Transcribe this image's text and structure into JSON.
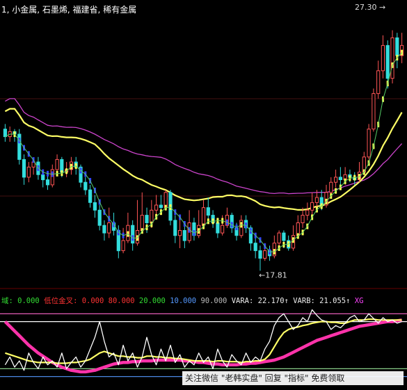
{
  "chart_data": [
    {
      "type": "candlestick",
      "panel": "price",
      "header": {
        "prefix": "1, ",
        "tags": [
          "小金属",
          "石墨烯",
          "福建省",
          "稀有金属"
        ]
      },
      "price_labels": {
        "high": "27.30",
        "low": "17.81"
      },
      "ylim": [
        17.3,
        28.0
      ],
      "candles": [
        [
          23.4,
          23.1,
          23.6,
          22.9
        ],
        [
          23.1,
          23.3,
          23.5,
          22.9
        ],
        [
          23.3,
          23.2,
          23.4,
          22.9
        ],
        [
          23.2,
          22.2,
          23.4,
          22.0
        ],
        [
          22.2,
          21.5,
          22.4,
          21.2
        ],
        [
          21.5,
          21.9,
          22.1,
          21.3
        ],
        [
          21.9,
          22.1,
          22.2,
          21.6
        ],
        [
          22.1,
          21.6,
          22.3,
          21.4
        ],
        [
          21.6,
          21.4,
          21.8,
          21.1
        ],
        [
          21.4,
          21.2,
          21.6,
          21.0
        ],
        [
          21.2,
          21.8,
          22.0,
          21.1
        ],
        [
          21.8,
          22.2,
          22.4,
          21.7
        ],
        [
          22.2,
          21.7,
          22.3,
          21.5
        ],
        [
          21.7,
          21.8,
          22.1,
          21.5
        ],
        [
          21.8,
          22.1,
          22.3,
          21.6
        ],
        [
          22.1,
          21.9,
          22.3,
          21.6
        ],
        [
          21.9,
          21.3,
          22.0,
          21.1
        ],
        [
          21.3,
          21.0,
          21.5,
          20.8
        ],
        [
          21.0,
          20.5,
          21.2,
          20.3
        ],
        [
          20.5,
          20.2,
          20.8,
          19.9
        ],
        [
          20.2,
          19.6,
          20.4,
          19.4
        ],
        [
          19.6,
          19.3,
          19.8,
          19.0
        ],
        [
          19.3,
          19.7,
          20.3,
          19.1
        ],
        [
          19.7,
          19.4,
          20.1,
          19.2
        ],
        [
          19.4,
          18.6,
          19.6,
          18.3
        ],
        [
          18.6,
          19.0,
          19.5,
          18.5
        ],
        [
          19.0,
          19.6,
          20.1,
          18.9
        ],
        [
          19.6,
          18.9,
          19.8,
          18.6
        ],
        [
          18.9,
          19.4,
          20.6,
          18.8
        ],
        [
          19.4,
          20.0,
          20.9,
          19.3
        ],
        [
          20.0,
          19.7,
          20.3,
          19.3
        ],
        [
          19.7,
          20.2,
          20.6,
          19.5
        ],
        [
          20.2,
          20.4,
          20.8,
          20.0
        ],
        [
          20.4,
          20.3,
          20.8,
          20.1
        ],
        [
          20.3,
          20.9,
          21.0,
          20.2
        ],
        [
          20.9,
          19.8,
          21.0,
          19.6
        ],
        [
          19.8,
          19.2,
          20.0,
          18.9
        ],
        [
          19.2,
          19.4,
          19.9,
          18.7
        ],
        [
          19.4,
          19.0,
          19.6,
          18.7
        ],
        [
          19.0,
          19.7,
          20.2,
          18.9
        ],
        [
          19.7,
          19.2,
          19.9,
          19.0
        ],
        [
          19.2,
          19.6,
          20.2,
          19.1
        ],
        [
          19.6,
          20.3,
          20.6,
          19.5
        ],
        [
          20.3,
          20.0,
          20.7,
          19.8
        ],
        [
          20.0,
          19.7,
          20.2,
          19.5
        ],
        [
          19.7,
          19.3,
          19.9,
          19.1
        ],
        [
          19.3,
          19.6,
          20.0,
          19.2
        ],
        [
          19.6,
          20.0,
          20.3,
          19.5
        ],
        [
          20.0,
          19.5,
          20.1,
          19.3
        ],
        [
          19.5,
          19.2,
          19.7,
          19.0
        ],
        [
          19.2,
          19.8,
          20.0,
          19.1
        ],
        [
          19.8,
          19.5,
          20.0,
          19.3
        ],
        [
          19.5,
          18.9,
          19.6,
          18.6
        ],
        [
          18.9,
          18.6,
          19.1,
          18.3
        ],
        [
          18.6,
          18.3,
          18.8,
          17.81
        ],
        [
          18.3,
          18.6,
          18.9,
          18.2
        ],
        [
          18.6,
          18.4,
          18.8,
          18.2
        ],
        [
          18.4,
          18.9,
          19.2,
          18.3
        ],
        [
          18.9,
          19.3,
          19.4,
          18.6
        ],
        [
          19.3,
          19.0,
          19.4,
          18.7
        ],
        [
          19.0,
          18.7,
          19.2,
          18.6
        ],
        [
          18.7,
          19.2,
          19.6,
          18.6
        ],
        [
          19.2,
          19.7,
          20.0,
          19.1
        ],
        [
          19.7,
          20.0,
          20.3,
          19.5
        ],
        [
          20.0,
          20.2,
          20.5,
          19.8
        ],
        [
          20.2,
          20.5,
          20.9,
          20.0
        ],
        [
          20.5,
          20.7,
          21.0,
          20.3
        ],
        [
          20.7,
          20.4,
          21.0,
          20.2
        ],
        [
          20.4,
          20.9,
          21.2,
          20.3
        ],
        [
          20.9,
          21.3,
          21.5,
          20.7
        ],
        [
          21.3,
          21.5,
          21.8,
          21.1
        ],
        [
          21.5,
          21.4,
          21.9,
          21.2
        ],
        [
          21.4,
          21.6,
          21.9,
          21.2
        ],
        [
          21.6,
          21.5,
          21.8,
          21.3
        ],
        [
          21.5,
          21.4,
          21.7,
          21.2
        ],
        [
          21.4,
          21.7,
          22.1,
          21.3
        ],
        [
          21.7,
          22.3,
          22.5,
          21.6
        ],
        [
          22.3,
          23.4,
          23.6,
          22.2
        ],
        [
          23.4,
          24.8,
          25.0,
          23.3
        ],
        [
          24.8,
          25.7,
          26.1,
          24.6
        ],
        [
          25.7,
          26.7,
          27.1,
          25.4
        ],
        [
          26.7,
          25.4,
          26.9,
          25.0
        ],
        [
          25.4,
          27.0,
          27.3,
          25.2
        ],
        [
          27.0,
          26.3,
          27.2,
          25.8
        ],
        [
          26.3,
          26.7,
          27.2,
          26.0
        ]
      ],
      "ma_short_color": "#ffffff",
      "ma_mid_color": "#ffff66",
      "ma_long_color": "#cc44cc",
      "bull_color": "#ff5555",
      "bear_color": "#33dddd",
      "trend_up_color": "#ffff55",
      "trend_down_color": "#3344ff"
    },
    {
      "type": "line",
      "panel": "indicator",
      "header": [
        {
          "label": "域:",
          "value": "0.000",
          "color": "#33dd33"
        },
        {
          "label": "低位金叉:",
          "value": "0.000",
          "color": "#ff3333"
        },
        {
          "label": "",
          "value": "80.000",
          "color": "#ff3333"
        },
        {
          "label": "",
          "value": "20.000",
          "color": "#33dd33"
        },
        {
          "label": "",
          "value": "10.000",
          "color": "#5599ff"
        },
        {
          "label": "",
          "value": "90.000",
          "color": "#bbbbbb"
        },
        {
          "label": "VARA:",
          "value": "22.170↑",
          "color": "#eeeeee"
        },
        {
          "label": "VARB:",
          "value": "21.055↑",
          "color": "#eeeeee"
        },
        {
          "label": "XG",
          "value": "",
          "color": "#ff44ff"
        }
      ],
      "ylim": [
        0,
        100
      ],
      "levels": [
        {
          "value": 90,
          "color": "#ff66cc"
        },
        {
          "value": 80,
          "color": "#ffffff"
        },
        {
          "value": 20,
          "color": "#88cc88"
        },
        {
          "value": 10,
          "color": "#5599ff"
        }
      ],
      "series": [
        {
          "name": "VARA",
          "color": "#ffffff",
          "values": [
            25,
            35,
            22,
            30,
            18,
            40,
            28,
            20,
            35,
            25,
            30,
            22,
            40,
            20,
            28,
            35,
            22,
            30,
            45,
            60,
            80,
            55,
            35,
            40,
            25,
            50,
            30,
            40,
            22,
            35,
            60,
            38,
            25,
            45,
            30,
            50,
            28,
            38,
            22,
            30,
            25,
            40,
            28,
            35,
            20,
            45,
            30,
            22,
            38,
            30,
            25,
            40,
            28,
            35,
            30,
            45,
            55,
            75,
            85,
            90,
            80,
            70,
            75,
            85,
            80,
            95,
            88,
            82,
            80,
            70,
            75,
            72,
            78,
            85,
            88,
            80,
            82,
            90,
            84,
            78,
            85,
            80,
            82,
            78,
            80
          ]
        },
        {
          "name": "VARB",
          "color": "#ffff66",
          "values": [
            40,
            38,
            36,
            34,
            32,
            30,
            29,
            28,
            28,
            28,
            28,
            27,
            27,
            27,
            28,
            28,
            29,
            30,
            32,
            36,
            40,
            42,
            40,
            38,
            36,
            36,
            35,
            35,
            34,
            34,
            36,
            36,
            35,
            35,
            34,
            34,
            33,
            33,
            32,
            31,
            30,
            30,
            30,
            30,
            29,
            30,
            30,
            29,
            29,
            29,
            28,
            29,
            29,
            30,
            30,
            32,
            38,
            48,
            58,
            66,
            70,
            72,
            73,
            75,
            76,
            78,
            79,
            80,
            80,
            79,
            79,
            78,
            78,
            80,
            82,
            82,
            82,
            83,
            83,
            82,
            82,
            82,
            82,
            82,
            82
          ]
        },
        {
          "name": "XG",
          "color": "#ff33aa",
          "values": [
            80,
            74,
            68,
            62,
            56,
            50,
            45,
            40,
            36,
            32,
            28,
            25,
            22,
            20,
            18,
            17,
            16,
            16,
            17,
            18,
            20,
            22,
            24,
            26,
            27,
            28,
            28,
            29,
            29,
            30,
            30,
            30,
            31,
            31,
            31,
            31,
            31,
            31,
            30,
            30,
            29,
            28,
            28,
            27,
            26,
            26,
            25,
            25,
            25,
            25,
            26,
            26,
            27,
            27,
            28,
            29,
            30,
            31,
            33,
            35,
            38,
            41,
            44,
            47,
            50,
            53,
            56,
            58,
            60,
            62,
            64,
            66,
            68,
            70,
            72,
            74,
            75,
            76,
            77,
            78,
            79,
            80,
            80,
            81,
            82
          ]
        }
      ]
    }
  ],
  "watermark": "关注微信 \"老韩实盘\" 回复 \"指标\" 免费领取"
}
